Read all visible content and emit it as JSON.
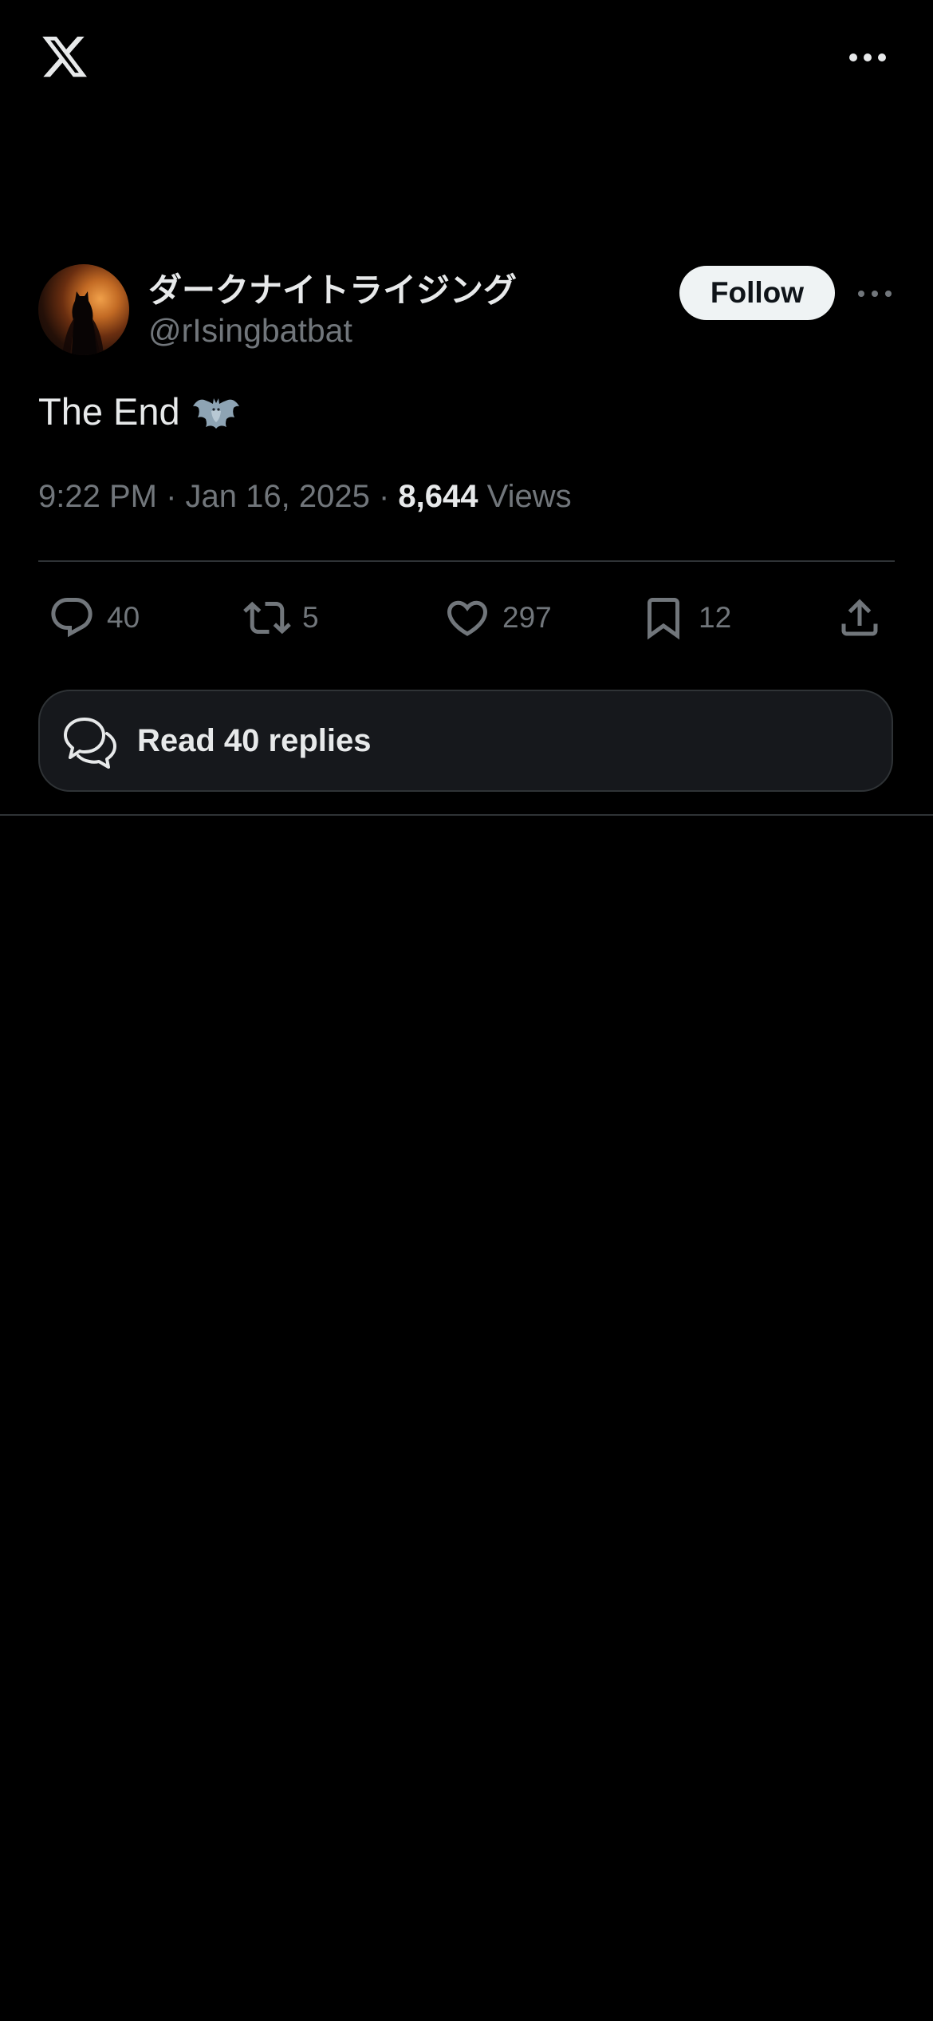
{
  "tweet": {
    "display_name": "ダークナイトライジング",
    "handle": "@rIsingbatbat",
    "text": "The End",
    "emoji": "bat-emoji",
    "time": "9:22 PM",
    "date": "Jan 16, 2025",
    "separator": " · ",
    "views_count": "8,644",
    "views_label": "Views"
  },
  "follow_label": "Follow",
  "actions": {
    "replies": "40",
    "reposts": "5",
    "likes": "297",
    "bookmarks": "12"
  },
  "read_replies_label": "Read 40 replies",
  "icons": {
    "logo": "x-logo-icon",
    "more": "more-horizontal-icon",
    "reply": "reply-icon",
    "repost": "repost-icon",
    "like": "heart-icon",
    "bookmark": "bookmark-icon",
    "share": "share-icon",
    "read_replies": "speech-bubbles-icon"
  },
  "colors": {
    "background": "#000000",
    "primary_text": "#e7e9ea",
    "secondary_text": "#71767b",
    "follow_bg": "#eff3f4",
    "divider": "#2f3336",
    "card_bg": "#16181c"
  }
}
